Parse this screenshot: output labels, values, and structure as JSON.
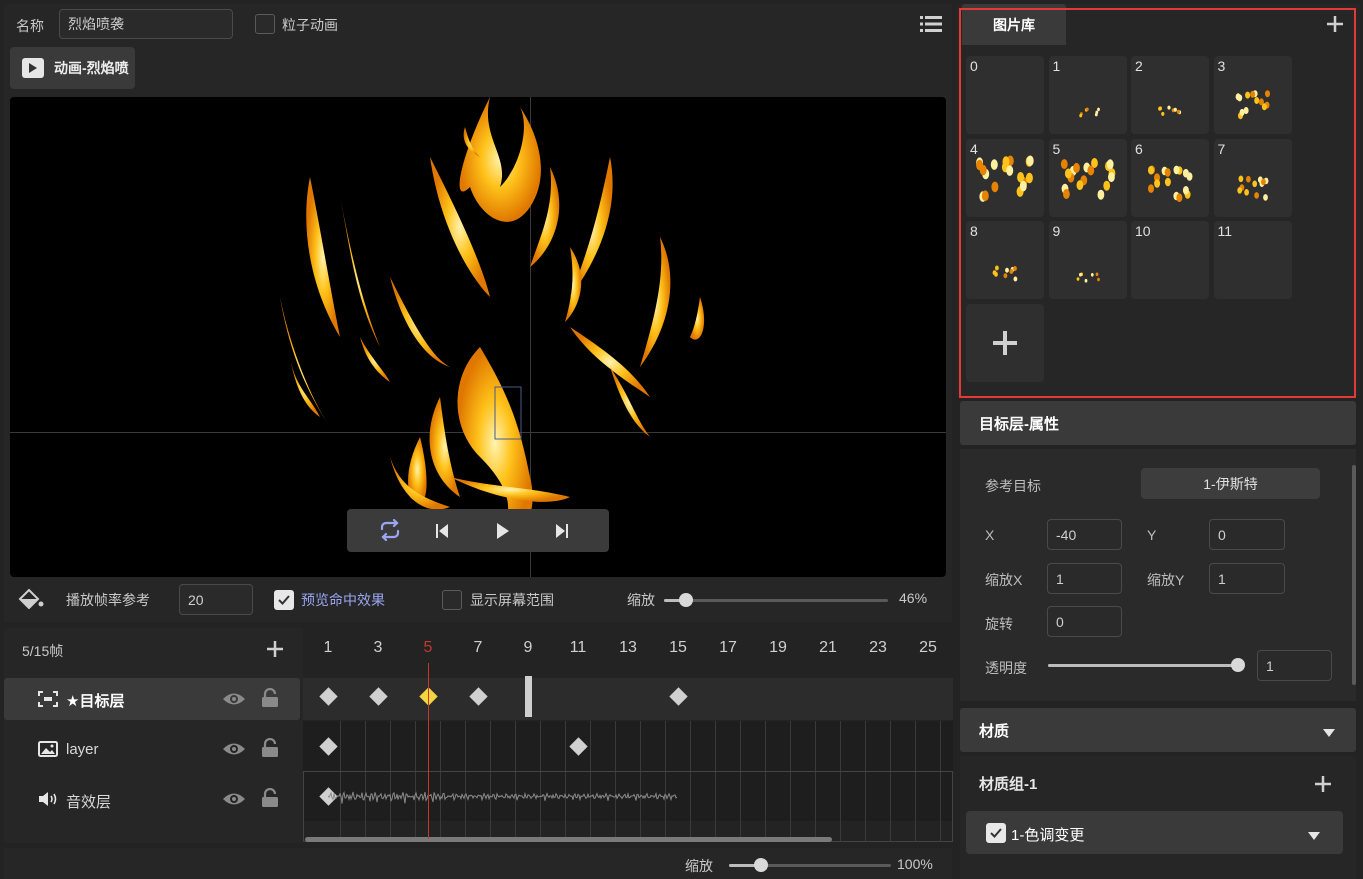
{
  "header": {
    "name_label": "名称",
    "name_value": "烈焰喷袭",
    "particle_label": "粒子动画",
    "anim_tab_label": "动画-烈焰喷"
  },
  "preview_controls": {
    "buttons": [
      "loop",
      "prev-frame",
      "play",
      "next-frame"
    ]
  },
  "settings_bar": {
    "fps_label": "播放帧率参考",
    "fps_value": "20",
    "hit_effect_label": "预览命中效果",
    "hit_effect_checked": true,
    "screen_range_label": "显示屏幕范围",
    "screen_range_checked": false,
    "zoom_label": "缩放",
    "zoom_value": "46%",
    "zoom_level": 0.1
  },
  "timeline": {
    "frame_status": "5/15帧",
    "current_frame": 5,
    "frame_numbers": [
      "1",
      "3",
      "5",
      "7",
      "9",
      "11",
      "13",
      "15",
      "17",
      "19",
      "21",
      "23",
      "25"
    ],
    "layers": [
      {
        "name": "★目标层",
        "icon": "target-icon",
        "keyframes": [
          1,
          3,
          5,
          7,
          15
        ],
        "marker": 9
      },
      {
        "name": "layer",
        "icon": "image-icon",
        "keyframes": [
          1,
          11
        ]
      },
      {
        "name": "音效层",
        "icon": "speaker-icon",
        "keyframes": [
          1
        ]
      }
    ],
    "zoom_label": "缩放",
    "zoom_value": "100%",
    "zoom_level": 0.2
  },
  "library": {
    "title": "图片库",
    "items": [
      "0",
      "1",
      "2",
      "3",
      "4",
      "5",
      "6",
      "7",
      "8",
      "9",
      "10",
      "11"
    ]
  },
  "properties": {
    "title": "目标层-属性",
    "ref_label": "参考目标",
    "ref_value": "1-伊斯特",
    "x_label": "X",
    "x_value": "-40",
    "y_label": "Y",
    "y_value": "0",
    "scale_x_label": "缩放X",
    "scale_x_value": "1",
    "scale_y_label": "缩放Y",
    "scale_y_value": "1",
    "rotation_label": "旋转",
    "rotation_value": "0",
    "opacity_label": "透明度",
    "opacity_value": "1",
    "opacity_level": 1.0
  },
  "material": {
    "title": "材质",
    "group_title": "材质组-1",
    "item_label": "1-色调变更",
    "item_checked": true
  },
  "colors": {
    "accent_highlight": "#e53935",
    "playhead": "#c0392b",
    "current_keyframe": "#f5d442",
    "hit_effect_text": "#9aa6f2"
  }
}
